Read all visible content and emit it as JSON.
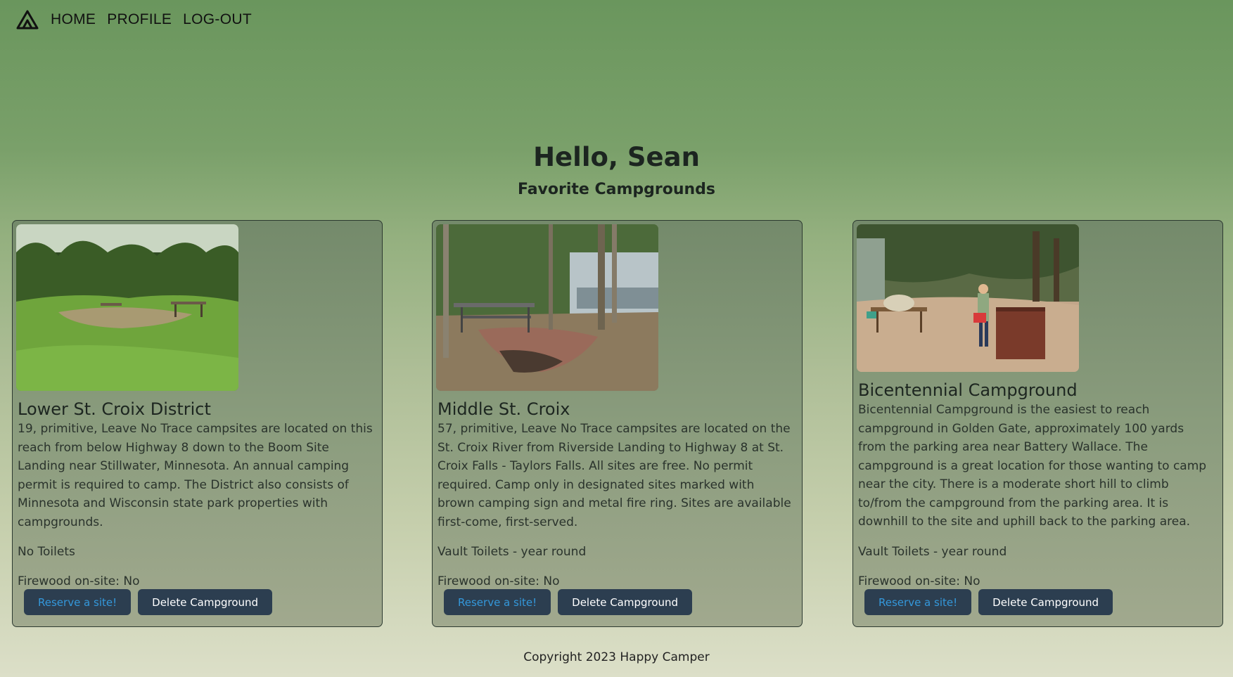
{
  "nav": {
    "home": "HOME",
    "profile": "PROFILE",
    "logout": "LOG-OUT"
  },
  "greeting": "Hello, Sean",
  "subtitle": "Favorite Campgrounds",
  "cards": [
    {
      "name": "Lower St. Croix District",
      "description": "19, primitive, Leave No Trace campsites are located on this reach from below Highway 8 down to the Boom Site Landing near Stillwater, Minnesota. An annual camping permit is required to camp. The District also consists of Minnesota and Wisconsin state park properties with campgrounds.",
      "toilets": "No Toilets",
      "firewood": "Firewood on-site: No",
      "reserve_label": "Reserve a site!",
      "delete_label": "Delete Campground"
    },
    {
      "name": "Middle St. Croix",
      "description": "57, primitive, Leave No Trace campsites are located on the St. Croix River from Riverside Landing to Highway 8 at St. Croix Falls - Taylors Falls. All sites are free. No permit required. Camp only in designated sites marked with brown camping sign and metal fire ring. Sites are available first-come, first-served.",
      "toilets": "Vault Toilets - year round",
      "firewood": "Firewood on-site: No",
      "reserve_label": "Reserve a site!",
      "delete_label": "Delete Campground"
    },
    {
      "name": "Bicentennial Campground",
      "description": "Bicentennial Campground is the easiest to reach campground in Golden Gate, approximately 100 yards from the parking area near Battery Wallace. The campground is a great location for those wanting to camp near the city. There is a moderate short hill to climb to/from the campground from the parking area. It is downhill to the site and uphill back to the parking area.",
      "toilets": "Vault Toilets - year round",
      "firewood": "Firewood on-site: No",
      "reserve_label": "Reserve a site!",
      "delete_label": "Delete Campground"
    }
  ],
  "footer": "Copyright 2023 Happy Camper",
  "colors": {
    "button_bg": "#2c3e50",
    "reserve_text": "#3498db",
    "delete_text": "#ffffff"
  }
}
